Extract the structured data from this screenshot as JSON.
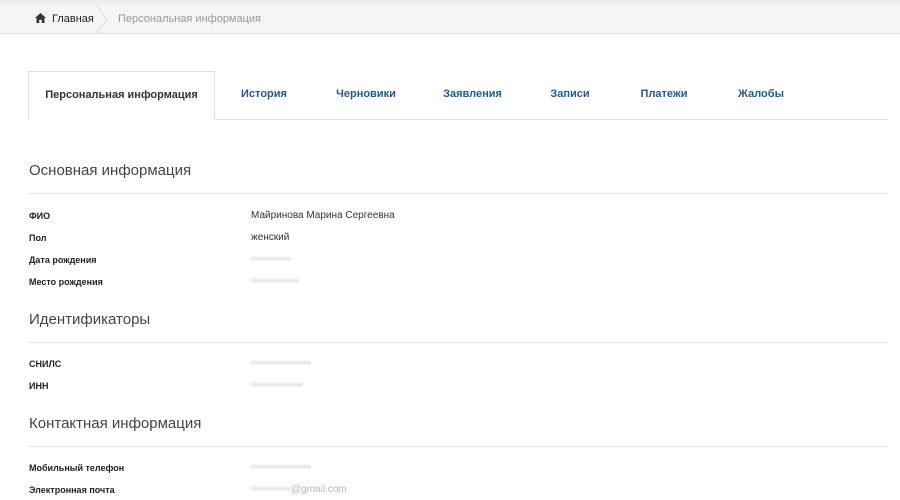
{
  "breadcrumb": {
    "home": "Главная",
    "current": "Персональная информация"
  },
  "tabs": [
    {
      "label": "Персональная информация",
      "active": true
    },
    {
      "label": "История",
      "active": false
    },
    {
      "label": "Черновики",
      "active": false
    },
    {
      "label": "Заявления",
      "active": false
    },
    {
      "label": "Записи",
      "active": false
    },
    {
      "label": "Платежи",
      "active": false
    },
    {
      "label": "Жалобы",
      "active": false
    }
  ],
  "sections": {
    "basic": {
      "title": "Основная информация",
      "fields": [
        {
          "label": "ФИО",
          "value": "Майринова Марина Сергеевна"
        },
        {
          "label": "Пол",
          "value": "женский"
        },
        {
          "label": "Дата рождения",
          "value": ""
        },
        {
          "label": "Место рождения",
          "value": ""
        }
      ]
    },
    "ids": {
      "title": "Идентификаторы",
      "fields": [
        {
          "label": "СНИЛС",
          "value": ""
        },
        {
          "label": "ИНН",
          "value": ""
        }
      ]
    },
    "contacts": {
      "title": "Контактная информация",
      "fields": [
        {
          "label": "Мобильный телефон",
          "value": ""
        },
        {
          "label": "Электронная почта",
          "value": "@gmail.com"
        }
      ]
    }
  },
  "colors": {
    "link": "#1f5a96",
    "breadcrumb_bg": "#f5f5f5",
    "divider": "#e5e5e5"
  }
}
